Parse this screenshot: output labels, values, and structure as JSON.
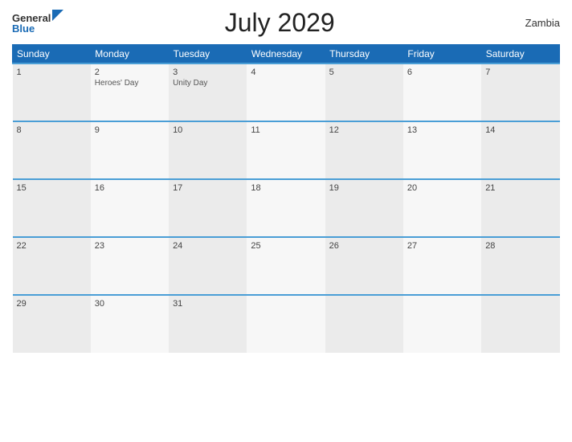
{
  "header": {
    "title": "July 2029",
    "country": "Zambia",
    "logo_general": "General",
    "logo_blue": "Blue"
  },
  "weekdays": [
    "Sunday",
    "Monday",
    "Tuesday",
    "Wednesday",
    "Thursday",
    "Friday",
    "Saturday"
  ],
  "weeks": [
    [
      {
        "day": "1",
        "events": []
      },
      {
        "day": "2",
        "events": [
          "Heroes' Day"
        ]
      },
      {
        "day": "3",
        "events": [
          "Unity Day"
        ]
      },
      {
        "day": "4",
        "events": []
      },
      {
        "day": "5",
        "events": []
      },
      {
        "day": "6",
        "events": []
      },
      {
        "day": "7",
        "events": []
      }
    ],
    [
      {
        "day": "8",
        "events": []
      },
      {
        "day": "9",
        "events": []
      },
      {
        "day": "10",
        "events": []
      },
      {
        "day": "11",
        "events": []
      },
      {
        "day": "12",
        "events": []
      },
      {
        "day": "13",
        "events": []
      },
      {
        "day": "14",
        "events": []
      }
    ],
    [
      {
        "day": "15",
        "events": []
      },
      {
        "day": "16",
        "events": []
      },
      {
        "day": "17",
        "events": []
      },
      {
        "day": "18",
        "events": []
      },
      {
        "day": "19",
        "events": []
      },
      {
        "day": "20",
        "events": []
      },
      {
        "day": "21",
        "events": []
      }
    ],
    [
      {
        "day": "22",
        "events": []
      },
      {
        "day": "23",
        "events": []
      },
      {
        "day": "24",
        "events": []
      },
      {
        "day": "25",
        "events": []
      },
      {
        "day": "26",
        "events": []
      },
      {
        "day": "27",
        "events": []
      },
      {
        "day": "28",
        "events": []
      }
    ],
    [
      {
        "day": "29",
        "events": []
      },
      {
        "day": "30",
        "events": []
      },
      {
        "day": "31",
        "events": []
      },
      {
        "day": "",
        "events": []
      },
      {
        "day": "",
        "events": []
      },
      {
        "day": "",
        "events": []
      },
      {
        "day": "",
        "events": []
      }
    ]
  ]
}
